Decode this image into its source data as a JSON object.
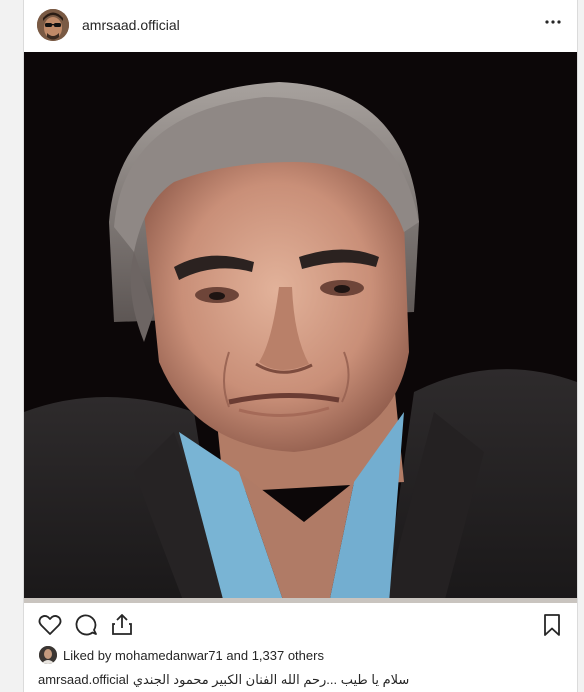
{
  "post": {
    "username": "amrsaad.official",
    "more_icon": "more-horizontal-icon",
    "photo_alt": "",
    "likes": {
      "prefix": "Liked by",
      "first_user": "mohamedanwar71",
      "connector": "and",
      "count": "1,337 others"
    },
    "caption": {
      "username": "amrsaad.official",
      "text": "سلام يا طيب ...رحم الله الفنان الكبير محمود الجندي"
    },
    "icons": {
      "like": "heart-icon",
      "comment": "comment-icon",
      "share": "share-icon",
      "save": "bookmark-icon"
    }
  }
}
